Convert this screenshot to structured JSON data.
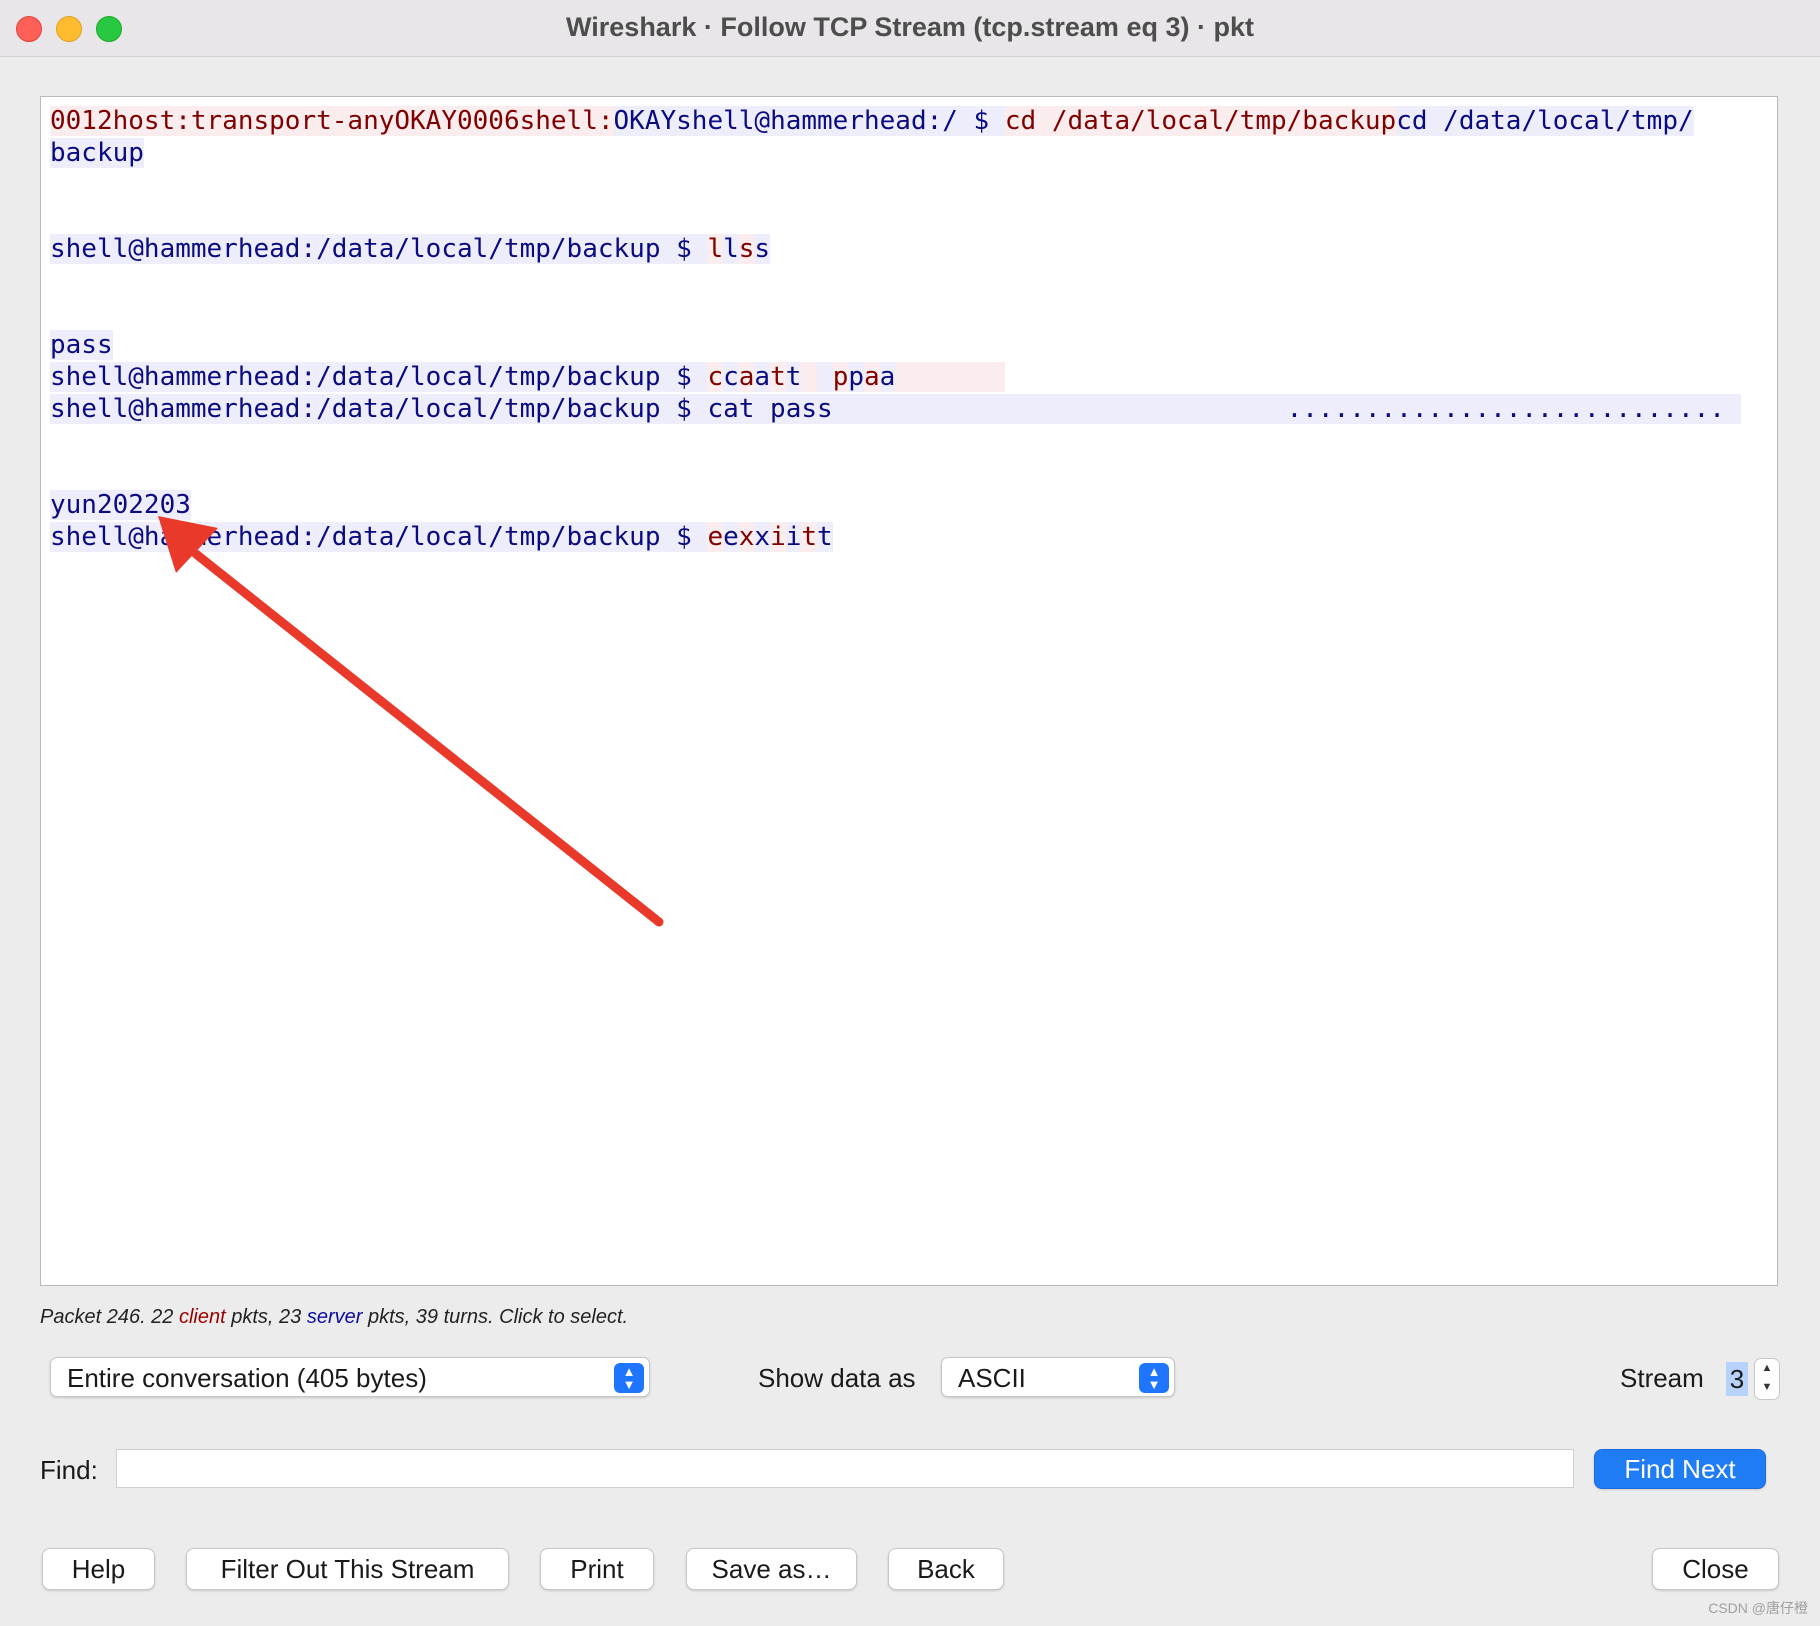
{
  "window": {
    "title": "Wireshark · Follow TCP Stream (tcp.stream eq 3) · pkt"
  },
  "stream_lines": [
    [
      [
        "c",
        "0012host:transport-anyOKAY0006shell:"
      ],
      [
        "s",
        "OKAYshell@hammerhead:/ $ "
      ],
      [
        "c",
        "cd /data/local/tmp/backup"
      ],
      [
        "s",
        "cd /data/local/tmp/"
      ]
    ],
    [
      [
        "s",
        "backup"
      ]
    ],
    [],
    [],
    [
      [
        "s",
        "shell@hammerhead:/data/local/tmp/backup $ "
      ],
      [
        "c",
        "l"
      ],
      [
        "s",
        "l"
      ],
      [
        "c",
        "s"
      ],
      [
        "s",
        "s"
      ]
    ],
    [],
    [],
    [
      [
        "s",
        "pass"
      ]
    ],
    [
      [
        "s",
        "shell@hammerhead:/data/local/tmp/backup $ "
      ],
      [
        "c",
        "c"
      ],
      [
        "s",
        "c"
      ],
      [
        "c",
        "a"
      ],
      [
        "s",
        "a"
      ],
      [
        "c",
        "t"
      ],
      [
        "s",
        "t"
      ],
      [
        "c",
        " "
      ],
      [
        "s",
        " "
      ],
      [
        "c",
        "p"
      ],
      [
        "s",
        "p"
      ],
      [
        "c",
        "a"
      ],
      [
        "s",
        "a"
      ],
      [
        "c",
        "       "
      ]
    ],
    [
      [
        "s",
        "shell@hammerhead:/data/local/tmp/backup $ cat pass                             ............................ "
      ]
    ],
    [],
    [],
    [
      [
        "s",
        "yun202203"
      ]
    ],
    [
      [
        "s",
        "shell@hammerhead:/data/local/tmp/backup $ "
      ],
      [
        "c",
        "e"
      ],
      [
        "s",
        "e"
      ],
      [
        "c",
        "x"
      ],
      [
        "s",
        "x"
      ],
      [
        "c",
        "i"
      ],
      [
        "s",
        "i"
      ],
      [
        "c",
        "t"
      ],
      [
        "s",
        "t"
      ]
    ]
  ],
  "status": {
    "prefix": "Packet 246. 22 ",
    "client": "client",
    "mid": " pkts, 23 ",
    "server": "server",
    "suffix": " pkts, 39 turns. Click to select."
  },
  "conversation_select": "Entire conversation (405 bytes)",
  "show_data_label": "Show data as",
  "show_data_value": "ASCII",
  "stream_label": "Stream",
  "stream_value": "3",
  "find_label": "Find:",
  "find_value": "",
  "find_next": "Find Next",
  "buttons": {
    "help": "Help",
    "filter_out": "Filter Out This Stream",
    "print": "Print",
    "save_as": "Save as…",
    "back": "Back",
    "close": "Close"
  },
  "watermark": "CSDN @唐仔橙",
  "colors": {
    "client_text": "#7f0000",
    "client_bg": "#fbedee",
    "server_text": "#0b0b80",
    "server_bg": "#ededfb",
    "annotation_arrow": "#e8392b",
    "primary_button": "#1f7cf5"
  }
}
